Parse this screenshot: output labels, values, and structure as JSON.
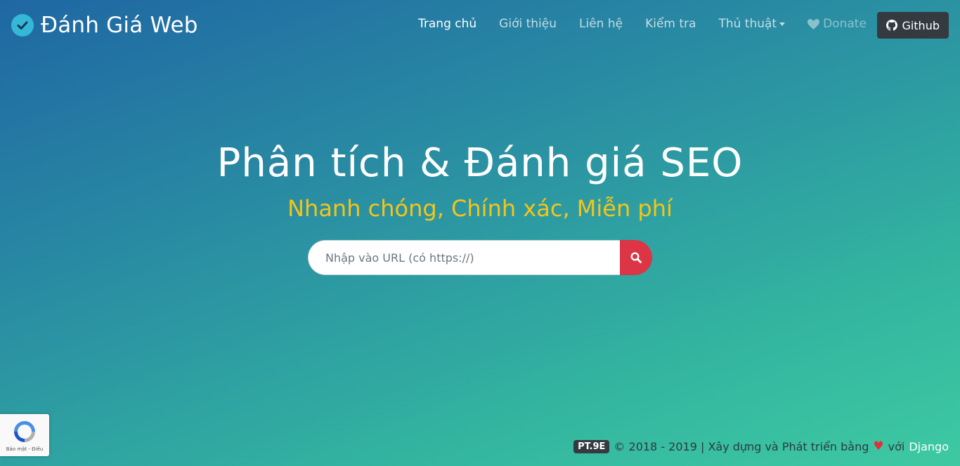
{
  "brand": {
    "title": "Đánh Giá Web",
    "icon": "check-circle-icon"
  },
  "nav": {
    "items": [
      {
        "label": "Trang chủ",
        "active": true
      },
      {
        "label": "Giới thiệu",
        "active": false
      },
      {
        "label": "Liên hệ",
        "active": false
      },
      {
        "label": "Kiểm tra",
        "active": false
      },
      {
        "label": "Thủ thuật",
        "active": false,
        "dropdown": true
      }
    ],
    "donate_label": "Donate",
    "github_label": "Github"
  },
  "hero": {
    "title": "Phân tích & Đánh giá SEO",
    "subtitle": "Nhanh chóng, Chính xác, Miễn phí"
  },
  "search": {
    "placeholder": "Nhập vào URL (có https://)",
    "value": ""
  },
  "recaptcha": {
    "text": "Bảo mật - Điều"
  },
  "footer": {
    "badge": "PT.9E",
    "text": "© 2018 - 2019 | Xây dựng và Phát triển bằng",
    "with_text": "với",
    "link": "Django"
  },
  "colors": {
    "subtitle": "#f5c518",
    "search_button": "#dc3545",
    "github_button": "#343a40",
    "heart": "#e0303a"
  }
}
